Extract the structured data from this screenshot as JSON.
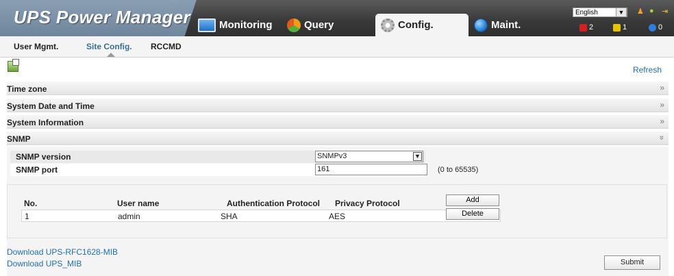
{
  "header": {
    "brand": "UPS Power Manager",
    "tabs": [
      {
        "label": "Monitoring",
        "icon": "monitor-icon"
      },
      {
        "label": "Query",
        "icon": "pie-icon"
      },
      {
        "label": "Config.",
        "icon": "gear-icon"
      },
      {
        "label": "Maint.",
        "icon": "globe-icon"
      }
    ],
    "active_tab": "Config.",
    "language": "English",
    "alarms": {
      "critical": "2",
      "major": "1",
      "info": "0"
    }
  },
  "subnav": {
    "items": [
      "User Mgmt.",
      "Site Config.",
      "RCCMD"
    ],
    "active": "Site Config."
  },
  "toolbar": {
    "refresh": "Refresh"
  },
  "sections": [
    {
      "title": "Time zone",
      "chevron": "»"
    },
    {
      "title": "System Date and Time",
      "chevron": "»"
    },
    {
      "title": "System Information",
      "chevron": "»"
    },
    {
      "title": "SNMP",
      "chevron": "»"
    }
  ],
  "snmp": {
    "version_label": "SNMP version",
    "version_value": "SNMPv3",
    "port_label": "SNMP port",
    "port_value": "161",
    "port_range": "(0 to 65535)",
    "columns": [
      "No.",
      "User name",
      "Authentication Protocol",
      "Privacy Protocol"
    ],
    "rows": [
      {
        "no": "1",
        "user": "admin",
        "auth": "SHA",
        "priv": "AES"
      }
    ],
    "add_label": "Add",
    "delete_label": "Delete"
  },
  "downloads": [
    "Download UPS-RFC1628-MIB",
    "Download UPS_MIB"
  ],
  "submit_label": "Submit"
}
